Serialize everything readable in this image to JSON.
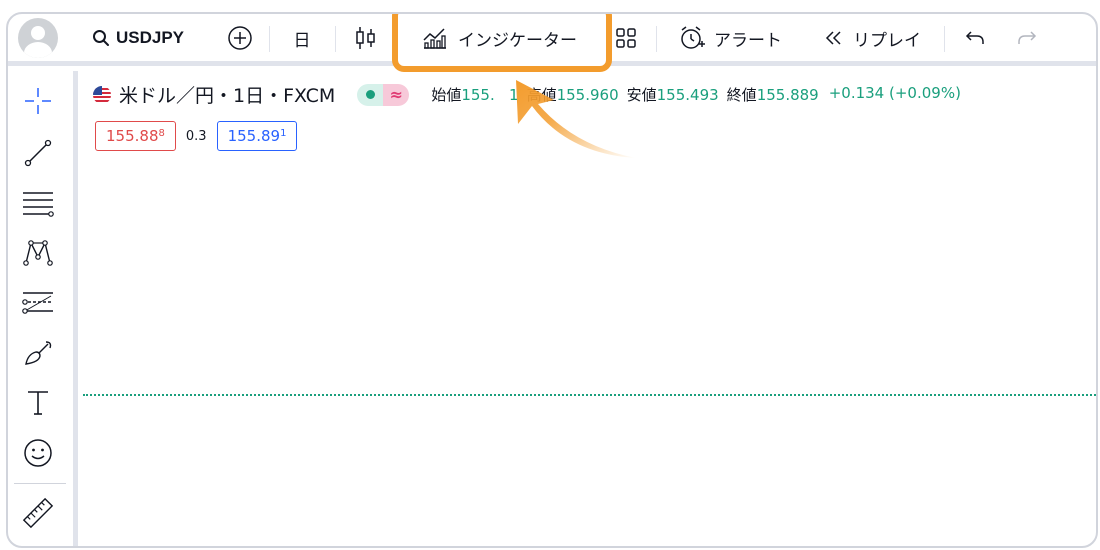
{
  "toolbar": {
    "symbol": "USDJPY",
    "interval": "日",
    "indicators_label": "インジケーター",
    "alert_label": "アラート",
    "replay_label": "リプレイ"
  },
  "legend": {
    "title": "米ドル／円・1日・FXCM",
    "open_label": "始値",
    "open_value": "155.   1",
    "high_label": "高値",
    "high_value": "155.960",
    "low_label": "安値",
    "low_value": "155.493",
    "close_label": "終値",
    "close_value": "155.889",
    "change": "+0.134 (+0.09%)",
    "status_pill_icon": "≈"
  },
  "prices": {
    "sell_main": "155.88",
    "sell_sup": "8",
    "spread": "0.3",
    "buy_main": "155.89",
    "buy_sup": "1"
  },
  "colors": {
    "highlight": "#f39c2d",
    "positive": "#1a9f7d",
    "sell": "#e04a4a",
    "buy": "#2962ff"
  }
}
